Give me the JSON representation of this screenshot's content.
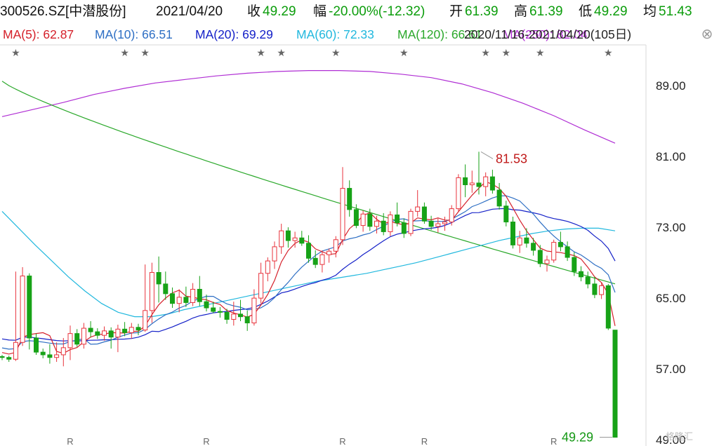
{
  "header": {
    "code": "300526.SZ[中潜股份]",
    "date": "2021/04/20",
    "close_label": "收",
    "close_value": "49.29",
    "change_label": "幅",
    "change_value": "-20.00%(-12.32)",
    "open_label": "开",
    "open_value": "61.39",
    "high_label": "高",
    "high_value": "61.39",
    "low_label": "低",
    "low_value": "49.29",
    "avg_label": "均",
    "avg_value": "51.43"
  },
  "ma_bar": {
    "ma5": "MA(5): 62.87",
    "ma10": "MA(10): 66.51",
    "ma20": "MA(20): 69.29",
    "ma60": "MA(60): 72.33",
    "ma120": "MA(120): 66.61",
    "ma250": "MA(250): 82.04",
    "range": "2020/11/16-2021/04/20(105日)",
    "close_symbol": "⊗"
  },
  "colors": {
    "up": "#e8333c",
    "down": "#17a217",
    "ma5": "#d5202a",
    "ma10": "#2e6fc4",
    "ma20": "#1420c8",
    "ma60": "#21b8de",
    "ma120": "#2aa82a",
    "ma250": "#b02ed4"
  },
  "annotations": {
    "high_label": "81.53",
    "low_label": "49.29"
  },
  "watermark": "格隆汇",
  "chart_data": {
    "type": "candlestick",
    "y_ticks": [
      "89.00",
      "81.00",
      "73.00",
      "65.00",
      "57.00",
      "49.00"
    ],
    "y_tick_values": [
      89,
      81,
      73,
      65,
      57,
      49
    ],
    "ylim": [
      48.3,
      93.6
    ],
    "x_markers": [
      "R",
      "R",
      "R",
      "R",
      "R"
    ],
    "x_marker_days": [
      10,
      30,
      50,
      62,
      81
    ],
    "star_days": [
      2,
      18,
      21,
      38,
      41,
      49,
      59,
      71,
      74,
      79,
      89
    ],
    "candles": [
      [
        58.4,
        58.6,
        58.0,
        58.3
      ],
      [
        58.3,
        58.5,
        57.8,
        58.1
      ],
      [
        58.1,
        68.0,
        57.9,
        60.0
      ],
      [
        60.0,
        68.5,
        59.6,
        67.5
      ],
      [
        67.5,
        67.8,
        59.2,
        60.5
      ],
      [
        60.5,
        61.0,
        58.6,
        58.9
      ],
      [
        58.9,
        59.3,
        58.2,
        58.6
      ],
      [
        58.6,
        59.8,
        57.6,
        58.3
      ],
      [
        58.3,
        60.0,
        57.8,
        58.6
      ],
      [
        58.6,
        60.5,
        57.3,
        59.4
      ],
      [
        59.4,
        61.9,
        58.0,
        61.0
      ],
      [
        61.0,
        61.5,
        59.5,
        59.8
      ],
      [
        59.8,
        62.2,
        59.3,
        61.6
      ],
      [
        61.6,
        62.4,
        60.6,
        61.2
      ],
      [
        61.2,
        61.6,
        60.4,
        60.8
      ],
      [
        60.8,
        61.8,
        60.2,
        61.3
      ],
      [
        61.3,
        61.7,
        59.3,
        60.6
      ],
      [
        60.6,
        62.0,
        58.9,
        61.5
      ],
      [
        61.5,
        62.3,
        60.7,
        61.1
      ],
      [
        61.1,
        62.2,
        60.4,
        61.7
      ],
      [
        61.7,
        62.1,
        60.8,
        61.4
      ],
      [
        61.4,
        68.8,
        61.2,
        63.6
      ],
      [
        63.6,
        69.0,
        62.2,
        67.9
      ],
      [
        67.9,
        69.7,
        64.5,
        66.6
      ],
      [
        66.6,
        68.0,
        64.8,
        65.5
      ],
      [
        65.5,
        66.2,
        63.9,
        64.4
      ],
      [
        64.4,
        66.0,
        63.4,
        65.1
      ],
      [
        65.1,
        66.3,
        64.0,
        64.5
      ],
      [
        64.5,
        66.7,
        64.1,
        66.0
      ],
      [
        66.0,
        67.5,
        64.1,
        64.6
      ],
      [
        64.6,
        65.4,
        63.5,
        63.9
      ],
      [
        63.9,
        64.6,
        63.3,
        63.5
      ],
      [
        63.5,
        64.0,
        62.8,
        63.4
      ],
      [
        63.4,
        63.8,
        62.1,
        62.6
      ],
      [
        62.6,
        64.6,
        61.9,
        63.2
      ],
      [
        63.2,
        64.8,
        62.4,
        62.9
      ],
      [
        62.9,
        63.6,
        61.3,
        62.2
      ],
      [
        62.2,
        66.0,
        61.9,
        65.0
      ],
      [
        65.0,
        69.0,
        64.4,
        67.8
      ],
      [
        67.8,
        69.6,
        66.9,
        69.2
      ],
      [
        69.2,
        71.4,
        68.3,
        70.8
      ],
      [
        70.8,
        73.4,
        70.0,
        72.6
      ],
      [
        72.6,
        73.0,
        70.7,
        71.5
      ],
      [
        71.5,
        72.5,
        70.7,
        71.8
      ],
      [
        71.8,
        72.6,
        70.9,
        71.2
      ],
      [
        71.2,
        72.1,
        69.0,
        69.5
      ],
      [
        69.5,
        70.4,
        68.4,
        68.8
      ],
      [
        68.8,
        70.4,
        67.9,
        69.9
      ],
      [
        69.9,
        70.6,
        69.0,
        70.3
      ],
      [
        70.3,
        72.0,
        69.6,
        71.6
      ],
      [
        71.6,
        79.8,
        71.0,
        77.4
      ],
      [
        77.4,
        78.3,
        74.2,
        75.0
      ],
      [
        75.0,
        75.6,
        72.9,
        73.2
      ],
      [
        73.2,
        74.9,
        72.5,
        74.5
      ],
      [
        74.5,
        75.1,
        72.6,
        73.1
      ],
      [
        73.1,
        74.3,
        72.3,
        73.7
      ],
      [
        73.7,
        74.6,
        72.1,
        72.5
      ],
      [
        72.5,
        74.8,
        72.0,
        74.4
      ],
      [
        74.4,
        75.8,
        73.1,
        73.5
      ],
      [
        73.5,
        74.0,
        71.8,
        72.3
      ],
      [
        72.3,
        75.1,
        72.0,
        74.8
      ],
      [
        74.8,
        77.2,
        74.2,
        75.3
      ],
      [
        75.3,
        75.8,
        73.4,
        73.7
      ],
      [
        73.7,
        74.3,
        72.7,
        73.1
      ],
      [
        73.1,
        74.0,
        72.4,
        73.4
      ],
      [
        73.4,
        74.2,
        72.6,
        73.6
      ],
      [
        73.6,
        75.5,
        73.2,
        75.1
      ],
      [
        75.1,
        79.0,
        74.8,
        78.6
      ],
      [
        78.6,
        80.1,
        76.4,
        77.8
      ],
      [
        77.8,
        79.4,
        76.9,
        78.0
      ],
      [
        78.0,
        81.53,
        76.7,
        77.6
      ],
      [
        77.6,
        79.2,
        76.5,
        78.7
      ],
      [
        78.7,
        79.5,
        76.8,
        77.2
      ],
      [
        77.2,
        78.0,
        75.0,
        75.4
      ],
      [
        75.4,
        76.0,
        73.1,
        73.6
      ],
      [
        73.6,
        74.2,
        70.6,
        71.0
      ],
      [
        71.0,
        72.6,
        70.1,
        71.8
      ],
      [
        71.8,
        72.9,
        70.7,
        71.2
      ],
      [
        71.2,
        71.8,
        69.8,
        70.4
      ],
      [
        70.4,
        71.0,
        68.5,
        68.9
      ],
      [
        68.9,
        69.8,
        68.0,
        69.3
      ],
      [
        69.3,
        71.6,
        69.0,
        71.3
      ],
      [
        71.3,
        72.5,
        70.3,
        70.8
      ],
      [
        70.8,
        71.4,
        69.2,
        69.6
      ],
      [
        69.6,
        70.2,
        67.5,
        68.0
      ],
      [
        68.0,
        68.6,
        66.9,
        67.4
      ],
      [
        67.4,
        68.0,
        66.1,
        66.6
      ],
      [
        66.6,
        67.4,
        65.0,
        65.4
      ],
      [
        65.4,
        66.8,
        64.9,
        66.4
      ],
      [
        66.4,
        66.6,
        61.4,
        61.61
      ],
      [
        61.39,
        61.39,
        49.29,
        49.29
      ]
    ],
    "ma250": [
      85.5,
      86.3,
      87.1,
      88.0,
      88.7,
      89.3,
      89.7,
      90.1,
      90.4,
      90.6,
      90.7,
      90.7,
      90.6,
      90.3,
      89.9,
      89.2,
      88.2,
      87.0,
      85.6,
      84.0,
      82.5
    ],
    "ma120_start": 89.5,
    "ma60_start": 77.5,
    "ma60": [
      74.8,
      72.9,
      71.0,
      69.2,
      67.4,
      65.8,
      64.4,
      63.4,
      62.9,
      62.9,
      63.2,
      63.7,
      64.1,
      64.5,
      64.9,
      65.3,
      65.7,
      66.1,
      66.5,
      66.9,
      67.2,
      67.5,
      67.8,
      68.2,
      68.6,
      69.0,
      69.5,
      70.0,
      70.5,
      71.0,
      71.5,
      71.9,
      72.3,
      72.6,
      72.8,
      72.9,
      72.9,
      72.6
    ]
  }
}
